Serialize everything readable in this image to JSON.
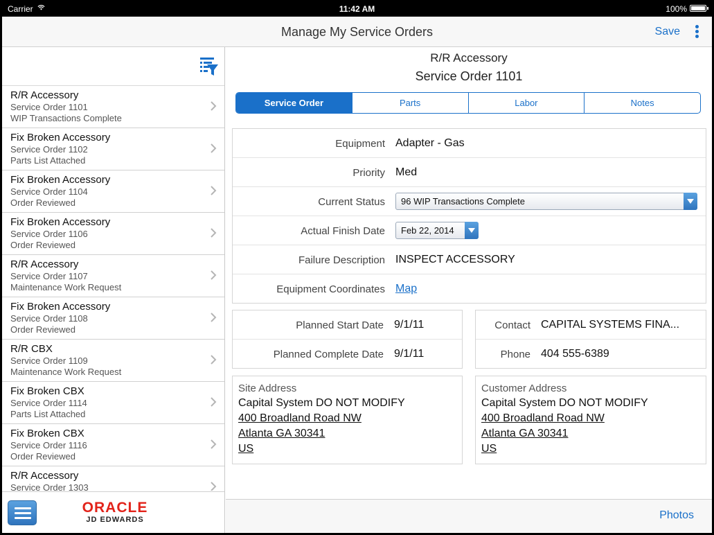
{
  "status_bar": {
    "carrier": "Carrier",
    "time": "11:42 AM",
    "battery": "100%"
  },
  "nav": {
    "title": "Manage My Service Orders",
    "save_label": "Save"
  },
  "list": [
    {
      "title": "R/R Accessory",
      "order": "Service Order 1101",
      "status": "WIP Transactions Complete"
    },
    {
      "title": "Fix Broken Accessory",
      "order": "Service Order 1102",
      "status": "Parts List Attached"
    },
    {
      "title": "Fix Broken Accessory",
      "order": "Service Order 1104",
      "status": "Order Reviewed"
    },
    {
      "title": "Fix Broken Accessory",
      "order": "Service Order 1106",
      "status": "Order Reviewed"
    },
    {
      "title": "R/R Accessory",
      "order": "Service Order 1107",
      "status": "Maintenance Work Request"
    },
    {
      "title": "Fix Broken Accessory",
      "order": "Service Order 1108",
      "status": "Order Reviewed"
    },
    {
      "title": "R/R CBX",
      "order": "Service Order 1109",
      "status": "Maintenance Work Request"
    },
    {
      "title": "Fix Broken CBX",
      "order": "Service Order 1114",
      "status": "Parts List Attached"
    },
    {
      "title": "Fix Broken CBX",
      "order": "Service Order 1116",
      "status": "Order Reviewed"
    },
    {
      "title": "R/R Accessory",
      "order": "Service Order 1303",
      "status": ""
    }
  ],
  "logo": {
    "brand": "ORACLE",
    "product": "JD EDWARDS"
  },
  "detail": {
    "title": "R/R Accessory",
    "subtitle": "Service Order 1101",
    "tabs": [
      "Service Order",
      "Parts",
      "Labor",
      "Notes"
    ],
    "equipment_label": "Equipment",
    "equipment": "Adapter - Gas",
    "priority_label": "Priority",
    "priority": "Med",
    "status_label": "Current Status",
    "status": "96 WIP Transactions Complete",
    "finish_label": "Actual Finish Date",
    "finish": "Feb 22, 2014",
    "failure_label": "Failure Description",
    "failure": "INSPECT ACCESSORY",
    "coords_label": "Equipment Coordinates",
    "coords_link": "Map",
    "planned_start_label": "Planned Start Date",
    "planned_start": "9/1/11",
    "planned_complete_label": "Planned Complete Date",
    "planned_complete": "9/1/11",
    "contact_label": "Contact",
    "contact": "CAPITAL SYSTEMS FINA...",
    "phone_label": "Phone",
    "phone": "404 555-6389",
    "site_address": {
      "heading": "Site Address",
      "name": "Capital System DO NOT MODIFY",
      "line1": "400 Broadland Road NW",
      "line2": "Atlanta GA 30341",
      "country": "US"
    },
    "customer_address": {
      "heading": "Customer Address",
      "name": "Capital System DO NOT MODIFY",
      "line1": "400 Broadland Road NW",
      "line2": "Atlanta GA 30341",
      "country": "US"
    },
    "photos_label": "Photos"
  },
  "colors": {
    "accent": "#1a70c9",
    "brand": "#e2231a"
  }
}
